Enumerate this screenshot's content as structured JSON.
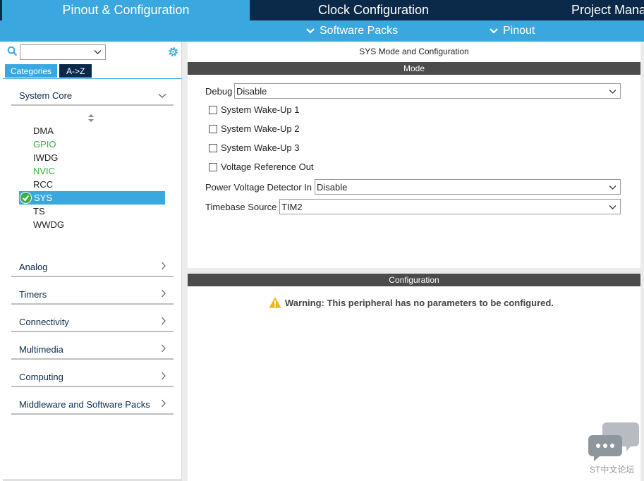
{
  "tabs": {
    "pinout": "Pinout & Configuration",
    "clock": "Clock Configuration",
    "project": "Project Mana"
  },
  "subbar": {
    "software_packs": "Software Packs",
    "pinout": "Pinout"
  },
  "sidebar": {
    "search_value": "",
    "category_tabs": [
      "Categories",
      "A->Z"
    ],
    "groups": [
      "System Core",
      "Analog",
      "Timers",
      "Connectivity",
      "Multimedia",
      "Computing",
      "Middleware and Software Packs"
    ],
    "system_core_items": [
      "DMA",
      "GPIO",
      "IWDG",
      "NVIC",
      "RCC",
      "SYS",
      "TS",
      "WWDG"
    ]
  },
  "main": {
    "title": "SYS Mode and Configuration",
    "mode_header": "Mode",
    "debug_label": "Debug",
    "debug_value": "Disable",
    "checkboxes": [
      "System Wake-Up 1",
      "System Wake-Up 2",
      "System Wake-Up 3",
      "Voltage Reference Out"
    ],
    "pvd_label": "Power Voltage Detector In",
    "pvd_value": "Disable",
    "timebase_label": "Timebase Source",
    "timebase_value": "TIM2",
    "config_header": "Configuration",
    "warning": "Warning: This peripheral has no parameters to be configured."
  },
  "watermark": {
    "text": "ST中文论坛"
  },
  "colors": {
    "accent": "#3aa8df",
    "dark": "#0b2a4a",
    "header_gray": "#4b4b4b",
    "ok_green": "#3aae4a",
    "warning": "#f5b400"
  }
}
